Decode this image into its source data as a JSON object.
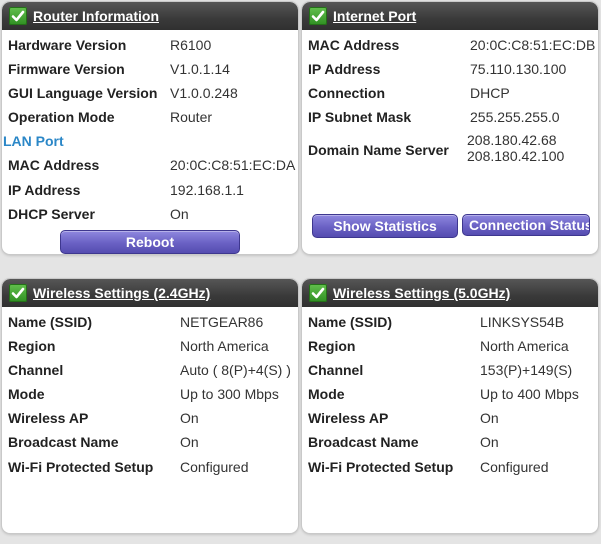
{
  "router": {
    "title": "Router Information",
    "rows": [
      {
        "label": "Hardware Version",
        "value": "R6100"
      },
      {
        "label": "Firmware Version",
        "value": "V1.0.1.14"
      },
      {
        "label": "GUI Language Version",
        "value": "V1.0.0.248"
      },
      {
        "label": "Operation Mode",
        "value": "Router"
      }
    ],
    "lan_title": "LAN Port",
    "lan_rows": [
      {
        "label": "MAC Address",
        "value": "20:0C:C8:51:EC:DA"
      },
      {
        "label": "IP Address",
        "value": "192.168.1.1"
      },
      {
        "label": "DHCP Server",
        "value": "On"
      }
    ],
    "reboot_label": "Reboot"
  },
  "internet": {
    "title": "Internet Port",
    "rows": [
      {
        "label": "MAC Address",
        "value": "20:0C:C8:51:EC:DB"
      },
      {
        "label": "IP Address",
        "value": "75.110.130.100"
      },
      {
        "label": "Connection",
        "value": "DHCP"
      },
      {
        "label": "IP Subnet Mask",
        "value": "255.255.255.0"
      }
    ],
    "dns_label": "Domain Name Server",
    "dns_values": [
      "208.180.42.68",
      "208.180.42.100"
    ],
    "show_stats_label": "Show Statistics",
    "conn_status_label": "Connection Status"
  },
  "wireless24": {
    "title": "Wireless Settings (2.4GHz)",
    "rows": [
      {
        "label": "Name (SSID)",
        "value": "NETGEAR86"
      },
      {
        "label": "Region",
        "value": "North America"
      },
      {
        "label": "Channel",
        "value": "Auto ( 8(P)+4(S) )"
      },
      {
        "label": "Mode",
        "value": "Up to 300 Mbps"
      },
      {
        "label": "Wireless AP",
        "value": "On"
      },
      {
        "label": "Broadcast Name",
        "value": "On"
      },
      {
        "label": "Wi-Fi Protected Setup",
        "value": "Configured"
      }
    ]
  },
  "wireless50": {
    "title": "Wireless Settings (5.0GHz)",
    "rows": [
      {
        "label": "Name (SSID)",
        "value": "LINKSYS54B"
      },
      {
        "label": "Region",
        "value": "North America"
      },
      {
        "label": "Channel",
        "value": "153(P)+149(S)"
      },
      {
        "label": "Mode",
        "value": "Up to 400 Mbps"
      },
      {
        "label": "Wireless AP",
        "value": "On"
      },
      {
        "label": "Broadcast Name",
        "value": "On"
      },
      {
        "label": "Wi-Fi Protected Setup",
        "value": "Configured"
      }
    ]
  },
  "colors": {
    "header": "#3a3a3a",
    "check": "#3fa22e",
    "section_blue": "#2b87c7",
    "button": "#6a61c4"
  },
  "icons": {
    "status": "checkmark-icon"
  }
}
